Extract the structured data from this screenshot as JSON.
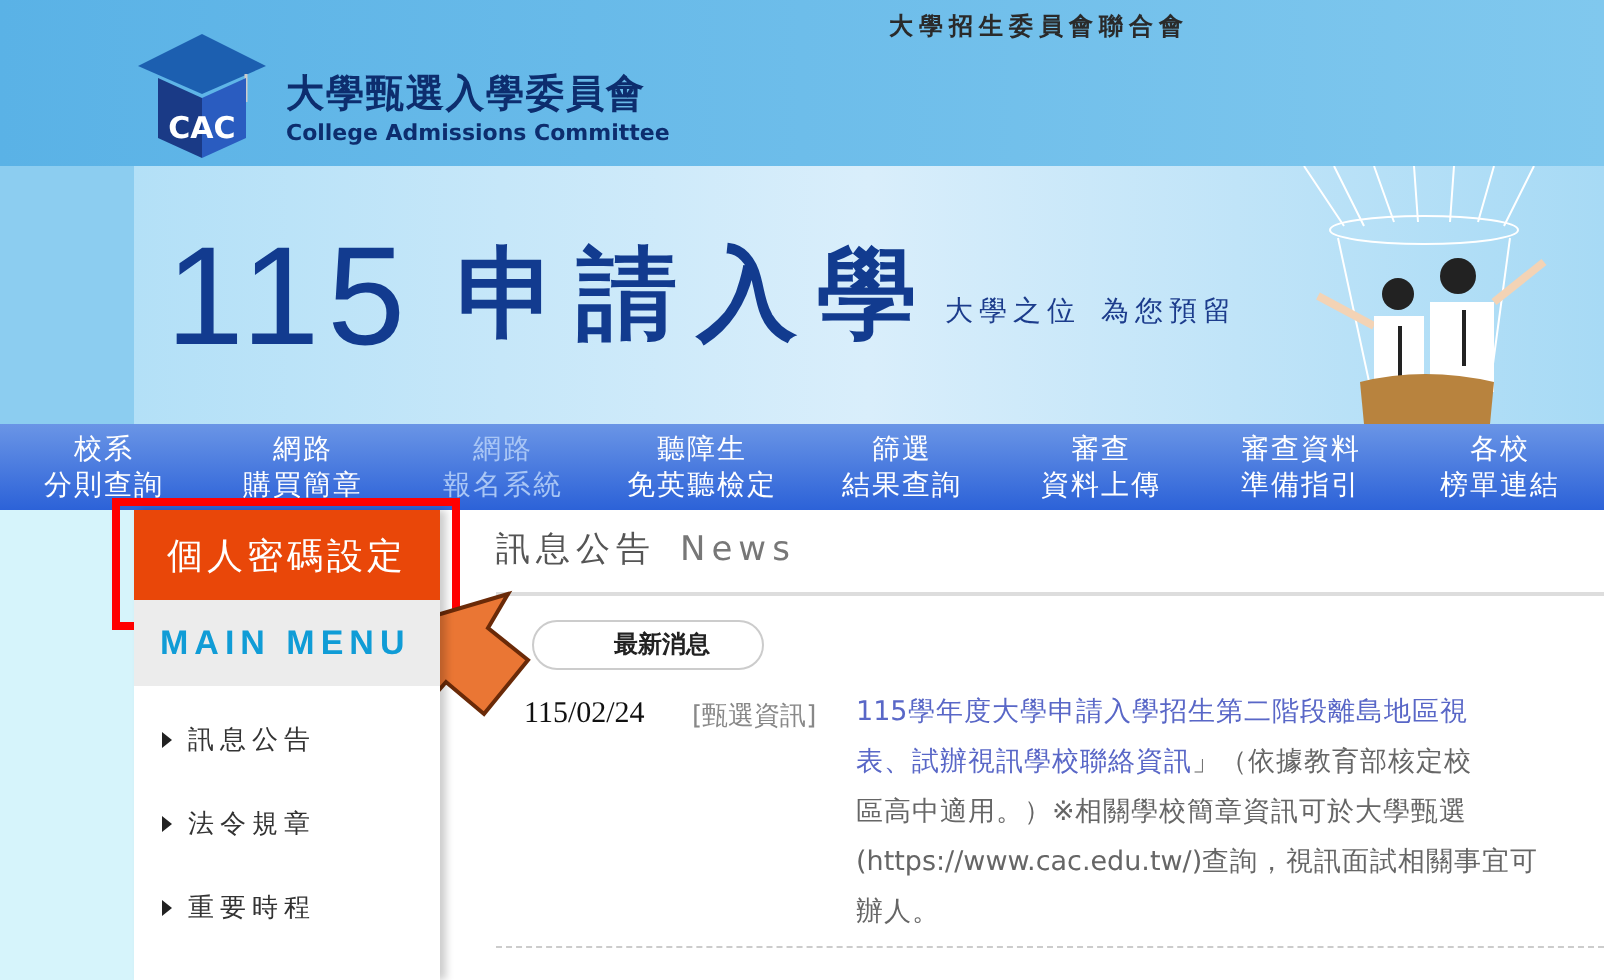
{
  "header": {
    "top_link": "大學招生委員會聯合會",
    "org_name": "大學甄選入學委員會",
    "org_name_en": "College Admissions Committee",
    "logo_text": "CAC"
  },
  "banner": {
    "title_number": "115",
    "title": "申請入學",
    "tagline_1": "大學之位",
    "tagline_2": "為您預留"
  },
  "nav": [
    {
      "line1": "校系",
      "line2": "分則查詢",
      "dimmed": false
    },
    {
      "line1": "網路",
      "line2": "購買簡章",
      "dimmed": false
    },
    {
      "line1": "網路",
      "line2": "報名系統",
      "dimmed": true
    },
    {
      "line1": "聽障生",
      "line2": "免英聽檢定",
      "dimmed": false
    },
    {
      "line1": "篩選",
      "line2": "結果查詢",
      "dimmed": false
    },
    {
      "line1": "審查",
      "line2": "資料上傳",
      "dimmed": false
    },
    {
      "line1": "審查資料",
      "line2": "準備指引",
      "dimmed": false
    },
    {
      "line1": "各校",
      "line2": "榜單連結",
      "dimmed": false
    }
  ],
  "sidebar": {
    "password_button": "個人密碼設定",
    "menu_title": "MAIN MENU",
    "items": [
      "訊息公告",
      "法令規章",
      "重要時程"
    ]
  },
  "news": {
    "heading": "訊息公告",
    "heading_en": "News",
    "tab": "最新消息",
    "items": [
      {
        "date": "115/02/24",
        "category": "[甄選資訊]",
        "lines": [
          [
            {
              "kind": "link",
              "text": "115學年度大學申請入學招生第二階段離島地區視"
            }
          ],
          [
            {
              "kind": "link",
              "text": "表、試辦視訊學校聯絡資訊"
            },
            {
              "kind": "plain",
              "text": "」（依據教育部核定校"
            }
          ],
          [
            {
              "kind": "plain",
              "text": "區高中適用。）※相關學校簡章資訊可於大學甄選"
            }
          ],
          [
            {
              "kind": "plain",
              "text": "(https://www.cac.edu.tw/)查詢，視訊面試相關事宜可"
            }
          ],
          [
            {
              "kind": "plain",
              "text": "辦人。"
            }
          ]
        ]
      }
    ]
  },
  "annotation": {
    "highlight_box": true,
    "arrow": true
  }
}
